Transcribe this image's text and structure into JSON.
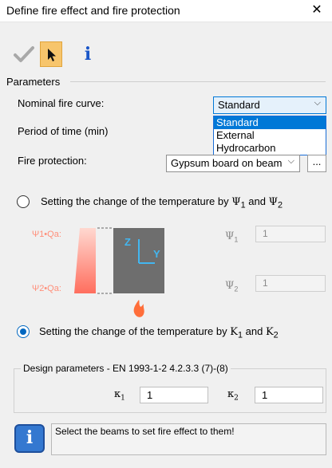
{
  "window": {
    "title": "Define fire effect and fire protection",
    "close": "✕"
  },
  "toolbar": {
    "info_glyph": "i"
  },
  "parameters": {
    "group_label": "Parameters",
    "fire_curve_label": "Nominal fire curve:",
    "fire_curve_value": "Standard",
    "fire_curve_options": [
      "Standard",
      "External",
      "Hydrocarbon"
    ],
    "period_label": "Period of time (min)",
    "fire_protection_label": "Fire protection:",
    "fire_protection_value": "Gypsum board on beam",
    "browse_label": "..."
  },
  "psi_option": {
    "text_prefix": "Setting the change of the temperature by",
    "sym1": "Ψ",
    "sub1": "1",
    "and": "and",
    "sym2": "Ψ",
    "sub2": "2",
    "checked": false
  },
  "illustration": {
    "psi1_label": "Ψ1•Qa:",
    "psi2_label": "Ψ2•Qa:",
    "axis_z": "Z",
    "axis_y": "Y",
    "fill_color": "#ff7d6b",
    "section_color": "#6e6e6e",
    "axis_color": "#42b6f0"
  },
  "psi_inputs": {
    "psi1_sym": "Ψ",
    "psi1_sub": "1",
    "psi1_value": "1",
    "psi2_sym": "Ψ",
    "psi2_sub": "2",
    "psi2_value": "1"
  },
  "k_option": {
    "text_prefix": "Setting the change of the temperature by",
    "sym1": "K",
    "sub1": "1",
    "and": "and",
    "sym2": "K",
    "sub2": "2",
    "checked": true
  },
  "design": {
    "title": "Design parameters - EN 1993-1-2 4.2.3.3 (7)-(8)",
    "k1_sym": "κ",
    "k1_sub": "1",
    "k1_value": "1",
    "k2_sym": "κ",
    "k2_sub": "2",
    "k2_value": "1"
  },
  "status": {
    "icon_glyph": "i",
    "message": "Select the beams to set fire effect to them!"
  }
}
